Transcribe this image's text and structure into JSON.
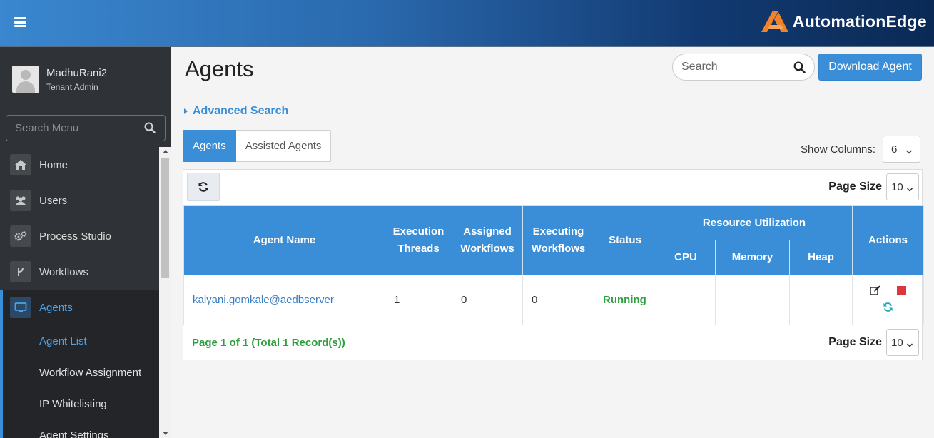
{
  "header": {
    "brand": "AutomationEdge",
    "colors": {
      "brand_orange": "#f0822a",
      "header_gradient_start": "#3a87cf",
      "header_gradient_end": "#0a2a55"
    },
    "menu_icon": "hamburger-icon"
  },
  "sidebar": {
    "user": {
      "name": "MadhuRani2",
      "role": "Tenant Admin"
    },
    "search": {
      "placeholder": "Search Menu",
      "icon": "search-icon"
    },
    "items": [
      {
        "label": "Home",
        "icon": "home-icon"
      },
      {
        "label": "Users",
        "icon": "users-icon"
      },
      {
        "label": "Process Studio",
        "icon": "gears-icon"
      },
      {
        "label": "Workflows",
        "icon": "workflow-icon"
      },
      {
        "label": "Agents",
        "icon": "monitor-icon",
        "active": true
      }
    ],
    "sub_items": [
      {
        "label": "Agent List",
        "active": true
      },
      {
        "label": "Workflow Assignment"
      },
      {
        "label": "IP Whitelisting"
      },
      {
        "label": "Agent Settings"
      }
    ],
    "colors": {
      "background": "#2f3236",
      "active_accent": "#3a8fd9"
    }
  },
  "main": {
    "title": "Agents",
    "search": {
      "placeholder": "Search",
      "icon": "search-icon"
    },
    "download_button": "Download Agent",
    "advanced_search": "Advanced Search",
    "tabs": [
      {
        "label": "Agents",
        "active": true
      },
      {
        "label": "Assisted Agents"
      }
    ],
    "show_columns": {
      "label": "Show Columns:",
      "value": "6"
    },
    "page_size": {
      "label": "Page Size",
      "value": "10"
    },
    "table": {
      "headers": {
        "agent_name": "Agent Name",
        "execution_threads": "Execution Threads",
        "assigned_workflows": "Assigned Workflows",
        "executing_workflows": "Executing Workflows",
        "status": "Status",
        "resource_utilization": "Resource Utilization",
        "cpu": "CPU",
        "memory": "Memory",
        "heap": "Heap",
        "actions": "Actions"
      },
      "rows": [
        {
          "agent_name": "kalyani.gomkale@aedbserver",
          "execution_threads": "1",
          "assigned_workflows": "0",
          "executing_workflows": "0",
          "status": "Running",
          "cpu": "",
          "memory": "",
          "heap": "",
          "actions": [
            "edit-icon",
            "stop-icon",
            "refresh-icon"
          ]
        }
      ]
    },
    "pagination": "Page 1 of 1 (Total 1 Record(s))",
    "colors": {
      "primary": "#3a8ed8",
      "status_running": "#2e9e3f",
      "stop_red": "#e0353f"
    }
  }
}
